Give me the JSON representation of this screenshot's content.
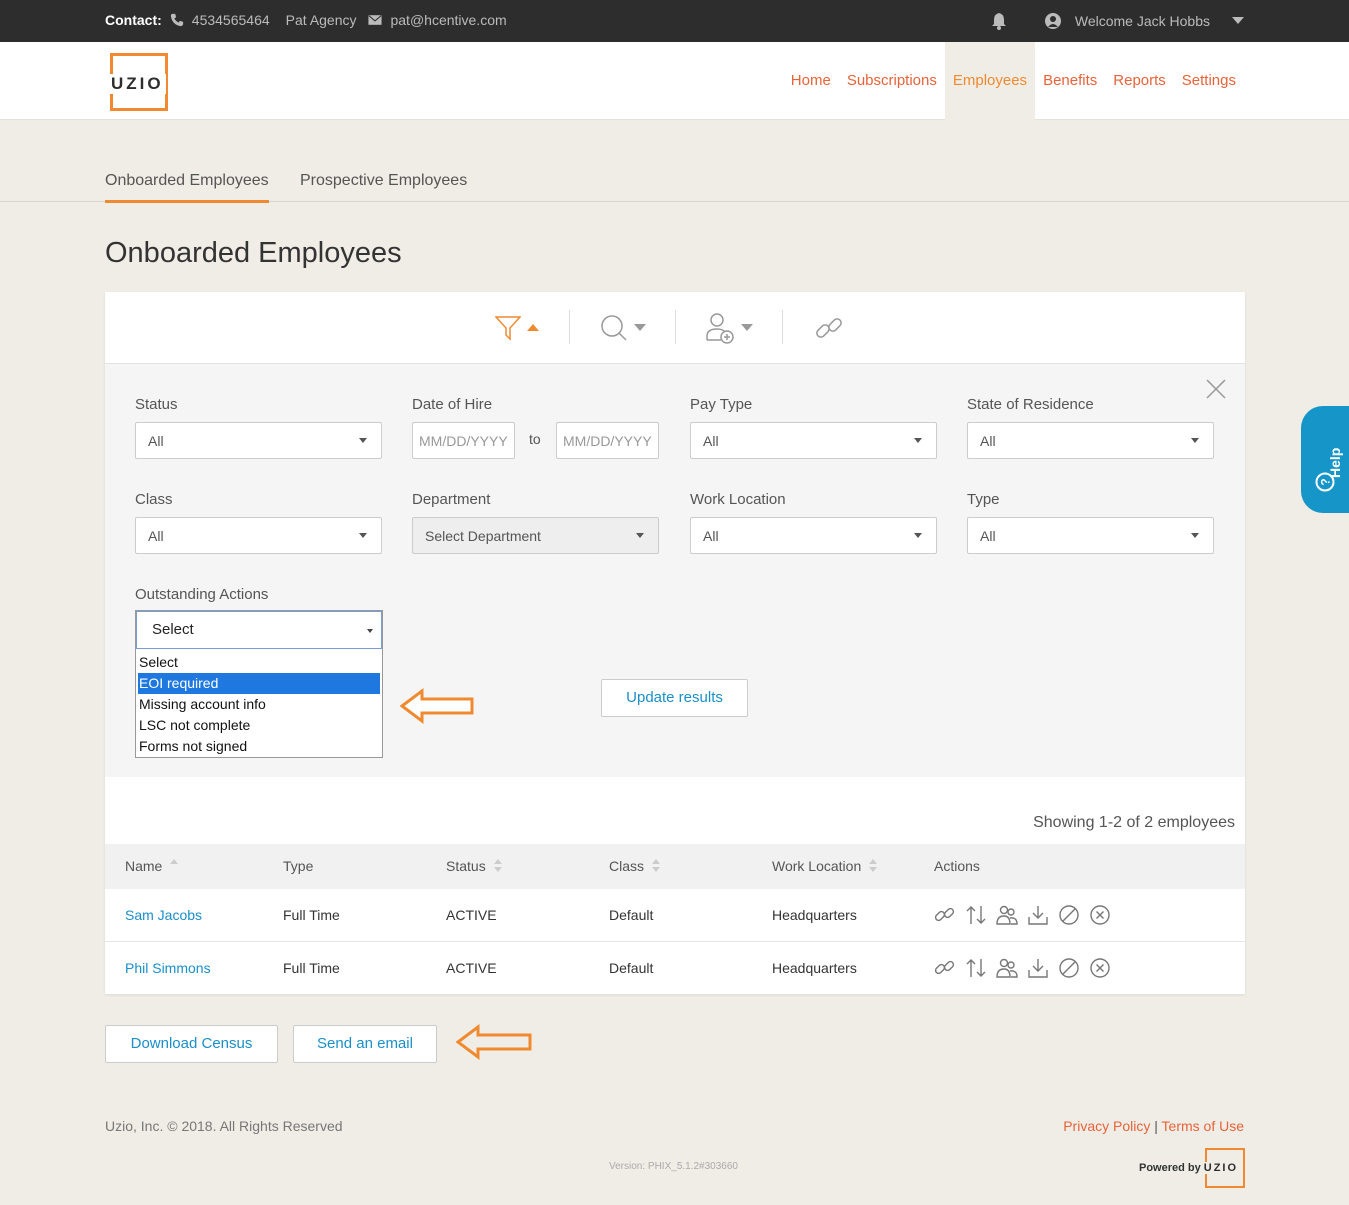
{
  "topbar": {
    "contact_label": "Contact:",
    "phone": "4534565464",
    "agency": "Pat Agency",
    "email": "pat@hcentive.com",
    "welcome": "Welcome Jack Hobbs"
  },
  "header": {
    "logo_text": "UZIO",
    "nav": [
      "Home",
      "Subscriptions",
      "Employees",
      "Benefits",
      "Reports",
      "Settings"
    ],
    "active_nav": "Employees"
  },
  "subtabs": [
    "Onboarded Employees",
    "Prospective Employees"
  ],
  "page_title": "Onboarded Employees",
  "filters": {
    "status": {
      "label": "Status",
      "value": "All"
    },
    "date_of_hire": {
      "label": "Date of Hire",
      "from_placeholder": "MM/DD/YYYY",
      "to_label": "to",
      "to_placeholder": "MM/DD/YYYY"
    },
    "pay_type": {
      "label": "Pay Type",
      "value": "All"
    },
    "state": {
      "label": "State of Residence",
      "value": "All"
    },
    "class": {
      "label": "Class",
      "value": "All"
    },
    "department": {
      "label": "Department",
      "value": "Select Department"
    },
    "work_location": {
      "label": "Work Location",
      "value": "All"
    },
    "type": {
      "label": "Type",
      "value": "All"
    },
    "outstanding": {
      "label": "Outstanding Actions",
      "value": "Select",
      "options": [
        "Select",
        "EOI required",
        "Missing account info",
        "LSC not complete",
        "Forms not signed"
      ],
      "highlighted": "EOI required"
    },
    "update_button": "Update results"
  },
  "table": {
    "showing": "Showing 1-2 of 2 employees",
    "headers": [
      "Name",
      "Type",
      "Status",
      "Class",
      "Work Location",
      "Actions"
    ],
    "rows": [
      {
        "name": "Sam Jacobs",
        "type": "Full Time",
        "status": "ACTIVE",
        "class": "Default",
        "location": "Headquarters"
      },
      {
        "name": "Phil Simmons",
        "type": "Full Time",
        "status": "ACTIVE",
        "class": "Default",
        "location": "Headquarters"
      }
    ]
  },
  "buttons": {
    "download_census": "Download Census",
    "send_email": "Send an email"
  },
  "help_label": "Help",
  "footer": {
    "copyright": "Uzio, Inc. © 2018. All Rights Reserved",
    "privacy": "Privacy Policy",
    "separator": "|",
    "terms": "Terms of Use",
    "version": "Version: PHIX_5.1.2#303660",
    "powered_by": "Powered by",
    "logo_text": "UZIO"
  },
  "colors": {
    "accent_orange": "#f08a30",
    "link_blue": "#1a8fc9",
    "topbar_bg": "#2d2d2d",
    "help_blue": "#1695c8"
  }
}
